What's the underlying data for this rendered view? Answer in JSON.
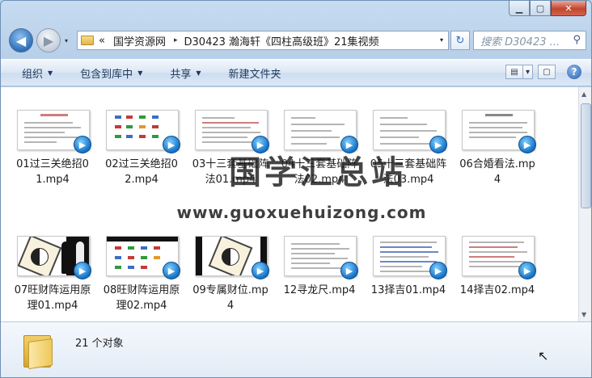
{
  "window": {
    "caption": {
      "minimize": "▁",
      "maximize": "▢",
      "close": "✕"
    }
  },
  "nav": {
    "back_icon": "◀",
    "forward_icon": "▶",
    "history_dropdown": "▾"
  },
  "address": {
    "prefix": "«",
    "segments": [
      "国学资源网",
      "D30423 瀚海轩《四柱高级班》21集视频"
    ],
    "separator": "▸",
    "dropdown": "▾"
  },
  "refresh_icon": "↻",
  "search": {
    "placeholder": "搜索 D30423 ...",
    "icon": "⚲"
  },
  "toolbar": {
    "organize": "组织",
    "include_in_library": "包含到库中",
    "share": "共享",
    "new_folder": "新建文件夹",
    "dropdown_arrow": "▼"
  },
  "view": {
    "change_view": "▤",
    "more": "▾",
    "preview_pane": "▢",
    "help": "?"
  },
  "files": [
    {
      "name": "01过三关绝招01.mp4",
      "thumb": "doc"
    },
    {
      "name": "02过三关绝招02.mp4",
      "thumb": "grid"
    },
    {
      "name": "03十三套基础阵法01.mp4",
      "thumb": "doc"
    },
    {
      "name": "04十三套基础阵法02.mp4",
      "thumb": "doc"
    },
    {
      "name": "05十三套基础阵法03.mp4",
      "thumb": "doc"
    },
    {
      "name": "06合婚看法.mp4",
      "thumb": "doc"
    },
    {
      "name": "07旺财阵运用原理01.mp4",
      "thumb": "bagua-figs"
    },
    {
      "name": "08旺财阵运用原理02.mp4",
      "thumb": "grid"
    },
    {
      "name": "09专属财位.mp4",
      "thumb": "bagua"
    },
    {
      "name": "12寻龙尺.mp4",
      "thumb": "doc"
    },
    {
      "name": "13择吉01.mp4",
      "thumb": "doc"
    },
    {
      "name": "14择吉02.mp4",
      "thumb": "doc"
    }
  ],
  "play_badge_icon": "▶",
  "watermark": {
    "title": "国学汇总站",
    "url": "www.guoxuehuizong.com"
  },
  "details": {
    "count": "21 个对象"
  },
  "scrollbar": {
    "up": "▲",
    "down": "▼"
  },
  "cursor_icon": "↖"
}
